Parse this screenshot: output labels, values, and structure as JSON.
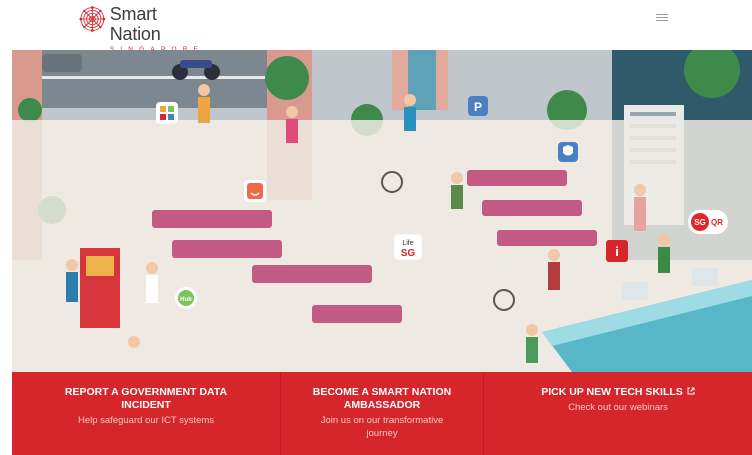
{
  "brand": {
    "name": "Smart Nation",
    "tagline": "SINGAPORE",
    "accent": "#d6252b"
  },
  "header": {
    "menu_icon": "hamburger-icon"
  },
  "hero": {
    "illustration": "service-centre-illustration",
    "app_badges": {
      "lifesg_line1": "Life",
      "lifesg_line2": "SG",
      "sgqr_sg": "SG",
      "sgqr_qr": "QR",
      "parking": "P",
      "info": "i",
      "hub": "Hub"
    }
  },
  "actions": [
    {
      "title": "REPORT A GOVERNMENT DATA INCIDENT",
      "subtitle": "Help safeguard our ICT systems"
    },
    {
      "title": "BECOME A SMART NATION AMBASSADOR",
      "subtitle": "Join us on our transformative journey"
    },
    {
      "title": "PICK UP NEW TECH SKILLS",
      "subtitle": "Check out our webinars",
      "icon": "external-link-icon"
    }
  ]
}
